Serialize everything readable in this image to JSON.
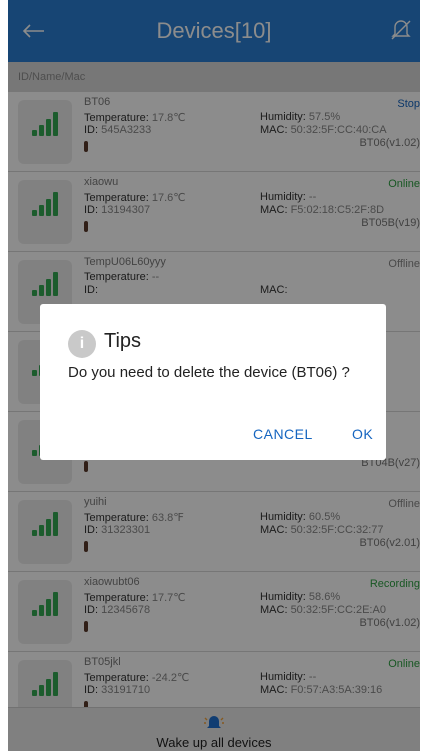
{
  "header": {
    "title": "Devices[10]",
    "back_icon": "back-arrow-icon",
    "bell_icon": "bell-off-icon"
  },
  "search": {
    "placeholder": "ID/Name/Mac"
  },
  "colors": {
    "header": "#2a7fd3",
    "online": "#2ea043",
    "recording": "#2ea043",
    "stop": "#1565c0",
    "offline": "#888888",
    "signal": "#34a853",
    "dialog_button": "#1565c0"
  },
  "devices": [
    {
      "name": "BT06",
      "status": "Stop",
      "status_color": "#1565c0",
      "temp_label": "Temperature:",
      "temp": "17.8℃",
      "id_label": "ID:",
      "id": "545A3233",
      "hum_label": "Humidity:",
      "hum": "57.5%",
      "mac_label": "MAC:",
      "mac": "50:32:5F:CC:40:CA",
      "ver": "BT06(v1.02)"
    },
    {
      "name": "xiaowu",
      "status": "Online",
      "status_color": "#2ea043",
      "temp_label": "Temperature:",
      "temp": "17.6℃",
      "id_label": "ID:",
      "id": "13194307",
      "hum_label": "Humidity:",
      "hum": "--",
      "mac_label": "MAC:",
      "mac": "F5:02:18:C5:2F:8D",
      "ver": "BT05B(v19)"
    },
    {
      "name": "TempU06L60yyy",
      "status": "Offline",
      "status_color": "#888888",
      "temp_label": "Temperature:",
      "temp": "--",
      "id_label": "ID:",
      "id": "",
      "hum_label": "",
      "hum": "",
      "mac_label": "MAC:",
      "mac": "",
      "ver": ""
    },
    {
      "name": "",
      "status": "",
      "status_color": "#2ea043",
      "temp_label": "",
      "temp": "",
      "id_label": "",
      "id": "",
      "hum_label": "",
      "hum": "",
      "mac_label": "",
      "mac": "",
      "ver": ""
    },
    {
      "name": "",
      "status": "",
      "status_color": "#2ea043",
      "temp_label": "",
      "temp": "",
      "id_label": "",
      "id": "",
      "hum_label": "",
      "hum": "",
      "mac_label": "",
      "mac": "",
      "ver": "BT04B(v27)"
    },
    {
      "name": "yuihi",
      "status": "Offline",
      "status_color": "#888888",
      "temp_label": "Temperature:",
      "temp": "63.8℉",
      "id_label": "ID:",
      "id": "31323301",
      "hum_label": "Humidity:",
      "hum": "60.5%",
      "mac_label": "MAC:",
      "mac": "50:32:5F:CC:32:77",
      "ver": "BT06(v2.01)"
    },
    {
      "name": "xiaowubt06",
      "status": "Recording",
      "status_color": "#2ea043",
      "temp_label": "Temperature:",
      "temp": "17.7℃",
      "id_label": "ID:",
      "id": "12345678",
      "hum_label": "Humidity:",
      "hum": "58.6%",
      "mac_label": "MAC:",
      "mac": "50:32:5F:CC:2E:A0",
      "ver": "BT06(v1.02)"
    },
    {
      "name": "BT05jkl",
      "status": "Online",
      "status_color": "#2ea043",
      "temp_label": "Temperature:",
      "temp": "-24.2℃",
      "id_label": "ID:",
      "id": "33191710",
      "hum_label": "Humidity:",
      "hum": "--",
      "mac_label": "MAC:",
      "mac": "F0:57:A3:5A:39:16",
      "ver": ""
    }
  ],
  "dialog": {
    "title": "Tips",
    "message": "Do you need to delete the device (BT06) ?",
    "cancel": "CANCEL",
    "ok": "OK",
    "icon": "info-icon"
  },
  "bottom": {
    "label": "Wake up all devices",
    "icon": "wake-icon"
  }
}
